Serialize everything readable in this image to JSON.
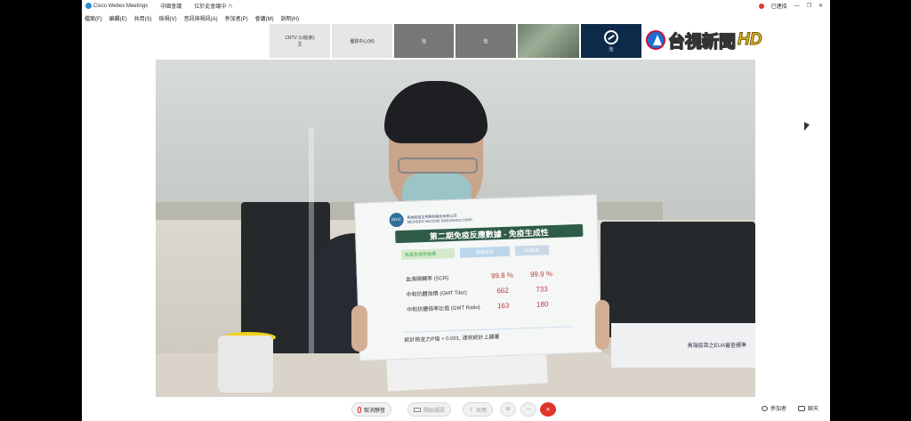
{
  "titlebar": {
    "app_name": "Cisco Webex Meetings",
    "item2": "中國會議",
    "item3": "位於此會議中 ∧",
    "right_label": "已連接",
    "win_min": "—",
    "win_max": "❐",
    "win_close": "✕"
  },
  "menu": [
    "檔案(F)",
    "編輯(E)",
    "共用(S)",
    "檢視(V)",
    "音訊與視訊(A)",
    "參加者(P)",
    "會議(M)",
    "說明(H)"
  ],
  "participants": [
    {
      "label": "CRTV 公視(新)",
      "sub": "主",
      "style": "light"
    },
    {
      "label": "優質中心(M)",
      "sub": "",
      "style": "light"
    },
    {
      "label": "陸",
      "sub": "",
      "style": "gray"
    },
    {
      "label": "陸",
      "sub": "",
      "style": "gray"
    },
    {
      "label": "",
      "sub": "",
      "style": "photo"
    },
    {
      "label": "陸",
      "sub": "",
      "style": "dark"
    }
  ],
  "broadcaster": {
    "name": "台視新聞",
    "suffix": "HD"
  },
  "board": {
    "logo": "MVC",
    "company_line1": "高端疫苗生物製劑股份有限公司",
    "company_line2": "MEDIGEN VACCINE BIOLOGICS CORP.",
    "title": "第二期免疫反應數據 - 免疫生成性",
    "kpi_label": "免疫生成性指標",
    "col1": "高端疫苗",
    "col2": "AZ疫苗",
    "rows": [
      {
        "label": "血清陽轉率 (SCR)",
        "v1": "99.8 %",
        "v2": "99.9 %"
      },
      {
        "label": "中和抗體效價 (GMT Titer)",
        "v1": "662",
        "v2": "733"
      },
      {
        "label": "中和抗體倍率比值 (GMT Ratio)",
        "v1": "163",
        "v2": "180"
      }
    ],
    "footer": "統計檢定力P值 < 0.001, 達到統計上顯著"
  },
  "nameplate": "高端疫苗之EUA審查標準",
  "bottom": {
    "mute": "取消靜音",
    "video": "開始視訊",
    "share": "共用",
    "participants": "參加者",
    "chat": "聊天"
  },
  "colors": {
    "end_button": "#e0352b",
    "board_title_bg": "#2f5c47"
  }
}
